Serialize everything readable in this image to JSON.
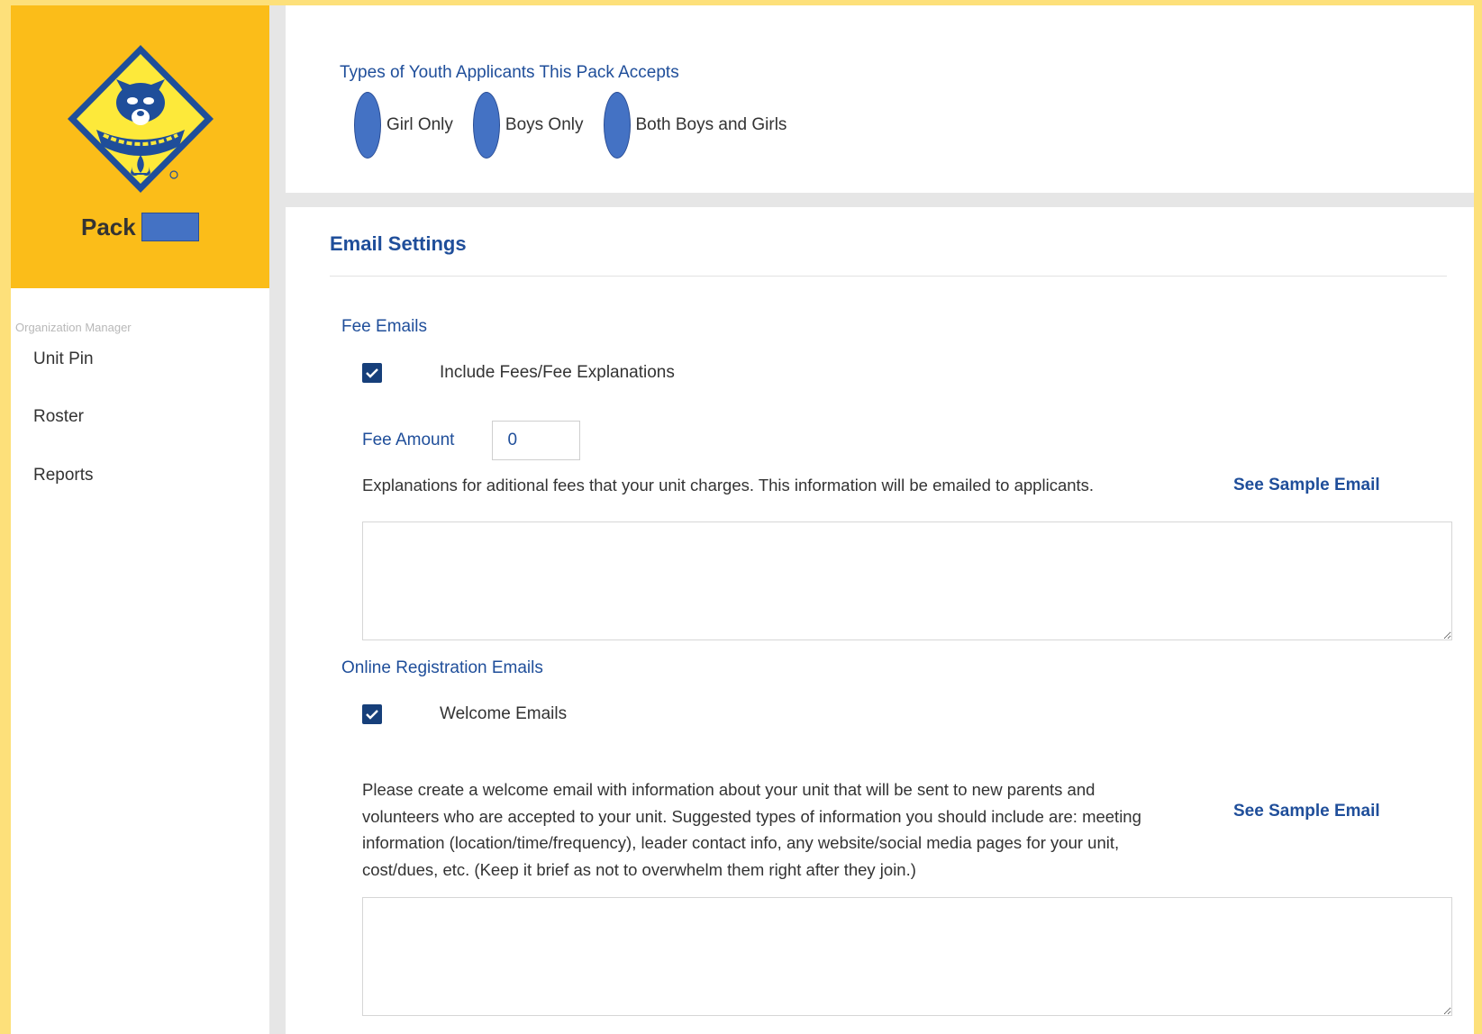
{
  "sidebar": {
    "pack_label": "Pack",
    "org_label": "Organization Manager",
    "items": [
      {
        "label": "Unit Pin"
      },
      {
        "label": "Roster"
      },
      {
        "label": "Reports"
      }
    ]
  },
  "youth": {
    "title": "Types of Youth Applicants This Pack Accepts",
    "options": [
      {
        "label": "Girl Only"
      },
      {
        "label": "Boys Only"
      },
      {
        "label": "Both Boys and Girls"
      }
    ]
  },
  "email_settings": {
    "title": "Email Settings",
    "fee_emails": {
      "title": "Fee Emails",
      "include_label": "Include Fees/Fee Explanations",
      "include_checked": true,
      "fee_amount_label": "Fee Amount",
      "fee_amount_value": "0",
      "explanation": "Explanations for aditional fees that your unit charges. This information will be emailed to applicants.",
      "sample_link": "See Sample Email",
      "textarea_value": ""
    },
    "online_registration": {
      "title": "Online Registration Emails",
      "welcome_label": "Welcome Emails",
      "welcome_checked": true,
      "description": "Please create a welcome email with information about your unit that will be sent to new parents and volunteers who are accepted to your unit. Suggested types of information you should include are: meeting information (location/time/frequency), leader contact info, any website/social media pages for your unit, cost/dues, etc. (Keep it brief as not to overwhelm them right after they join.)",
      "sample_link": "See Sample Email",
      "textarea_value": ""
    }
  },
  "colors": {
    "brand_gold": "#fbbd19",
    "page_border": "#fde07a",
    "accent_blue": "#1f4e9a",
    "radio_fill": "#4472c4",
    "checkbox_fill": "#163f7a"
  },
  "icons": {
    "logo": "cub-scouts-logo",
    "checkbox": "check-icon"
  }
}
